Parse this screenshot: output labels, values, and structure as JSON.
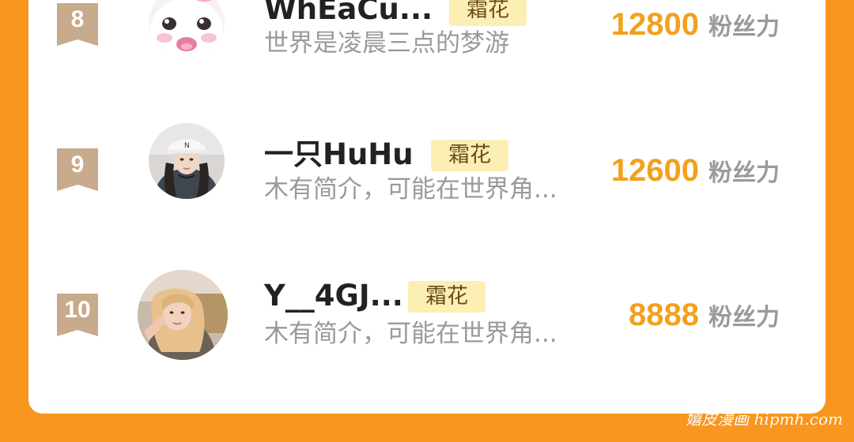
{
  "colors": {
    "background": "#F9961F",
    "card": "#FFFFFF",
    "rank_badge": "#C8AA8C",
    "score": "#F2A11D",
    "tag_bg": "#FCEFB4",
    "muted_text": "#9A9A9A"
  },
  "entries": [
    {
      "rank": "8",
      "name": "WhEaCu...",
      "tag": "霜花",
      "bio": "世界是凌晨三点的梦游",
      "score": "12800",
      "score_unit": "粉丝力",
      "avatar_icon": "hello-kitty-avatar"
    },
    {
      "rank": "9",
      "name": "一只HuHu",
      "tag": "霜花",
      "bio": "木有简介，可能在世界角...",
      "score": "12600",
      "score_unit": "粉丝力",
      "avatar_icon": "girl-in-white-cap-avatar"
    },
    {
      "rank": "10",
      "name": "Y__4GJ...",
      "tag": "霜花",
      "bio": "木有简介，可能在世界角...",
      "score": "8888",
      "score_unit": "粉丝力",
      "avatar_icon": "blonde-girl-avatar"
    }
  ],
  "watermark": "嬉皮漫画 hipmh.com"
}
